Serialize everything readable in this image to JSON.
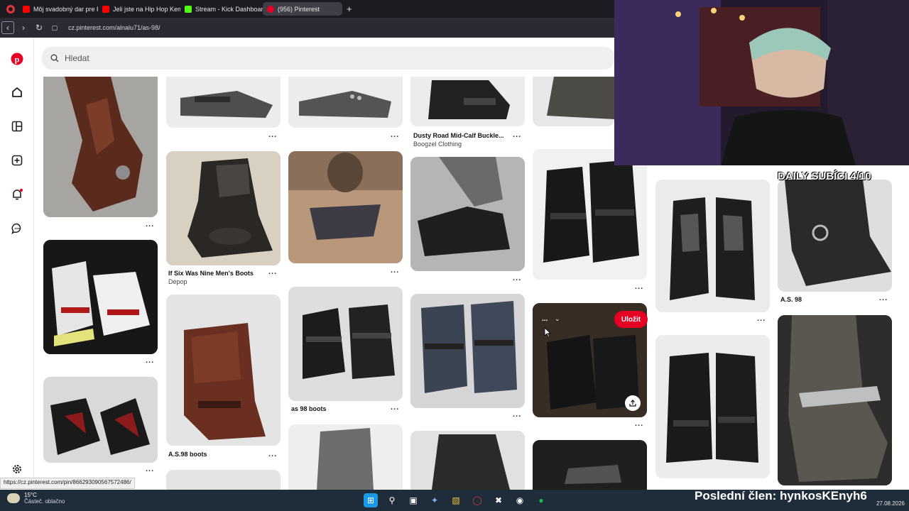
{
  "browser": {
    "tabs": [
      {
        "label": "Môj svadobný dar pre Fil...",
        "fav_color": "#ff0000"
      },
      {
        "label": "Jeli jste na Hip Hop Kemp...",
        "fav_color": "#ff0000"
      },
      {
        "label": "Stream - Kick Dashboard",
        "fav_color": "#53fc18"
      },
      {
        "label": "(956) Pinterest",
        "fav_color": "#e60023"
      }
    ],
    "new_tab": "+",
    "url": "cz.pinterest.com/alnalu71/as-98/"
  },
  "pinterest": {
    "search_placeholder": "Hledat",
    "pins": [
      {
        "title": "Dusty Road Mid-Calf Buckle...",
        "source": "Boogzel Clothing"
      },
      {
        "title": "If Six Was Nine Men's Boots",
        "source": "Depop"
      },
      {
        "title": "A.S. 98",
        "source": ""
      },
      {
        "title": "as 98 boots",
        "source": ""
      },
      {
        "title": "A.S.98 boots",
        "source": ""
      }
    ],
    "more_label": "...",
    "save_label": "Uložit",
    "hover_menu": "...",
    "status_url": "https://cz.pinterest.com/pin/866293090567572486/"
  },
  "stream": {
    "subs_text": "DAILY SUBÍCI 4/10",
    "member_text": "Poslední člen: hynkosKEnyh6"
  },
  "taskbar": {
    "temperature": "15°C",
    "weather": "Částeč. oblačno",
    "date": "27.08.2026"
  }
}
